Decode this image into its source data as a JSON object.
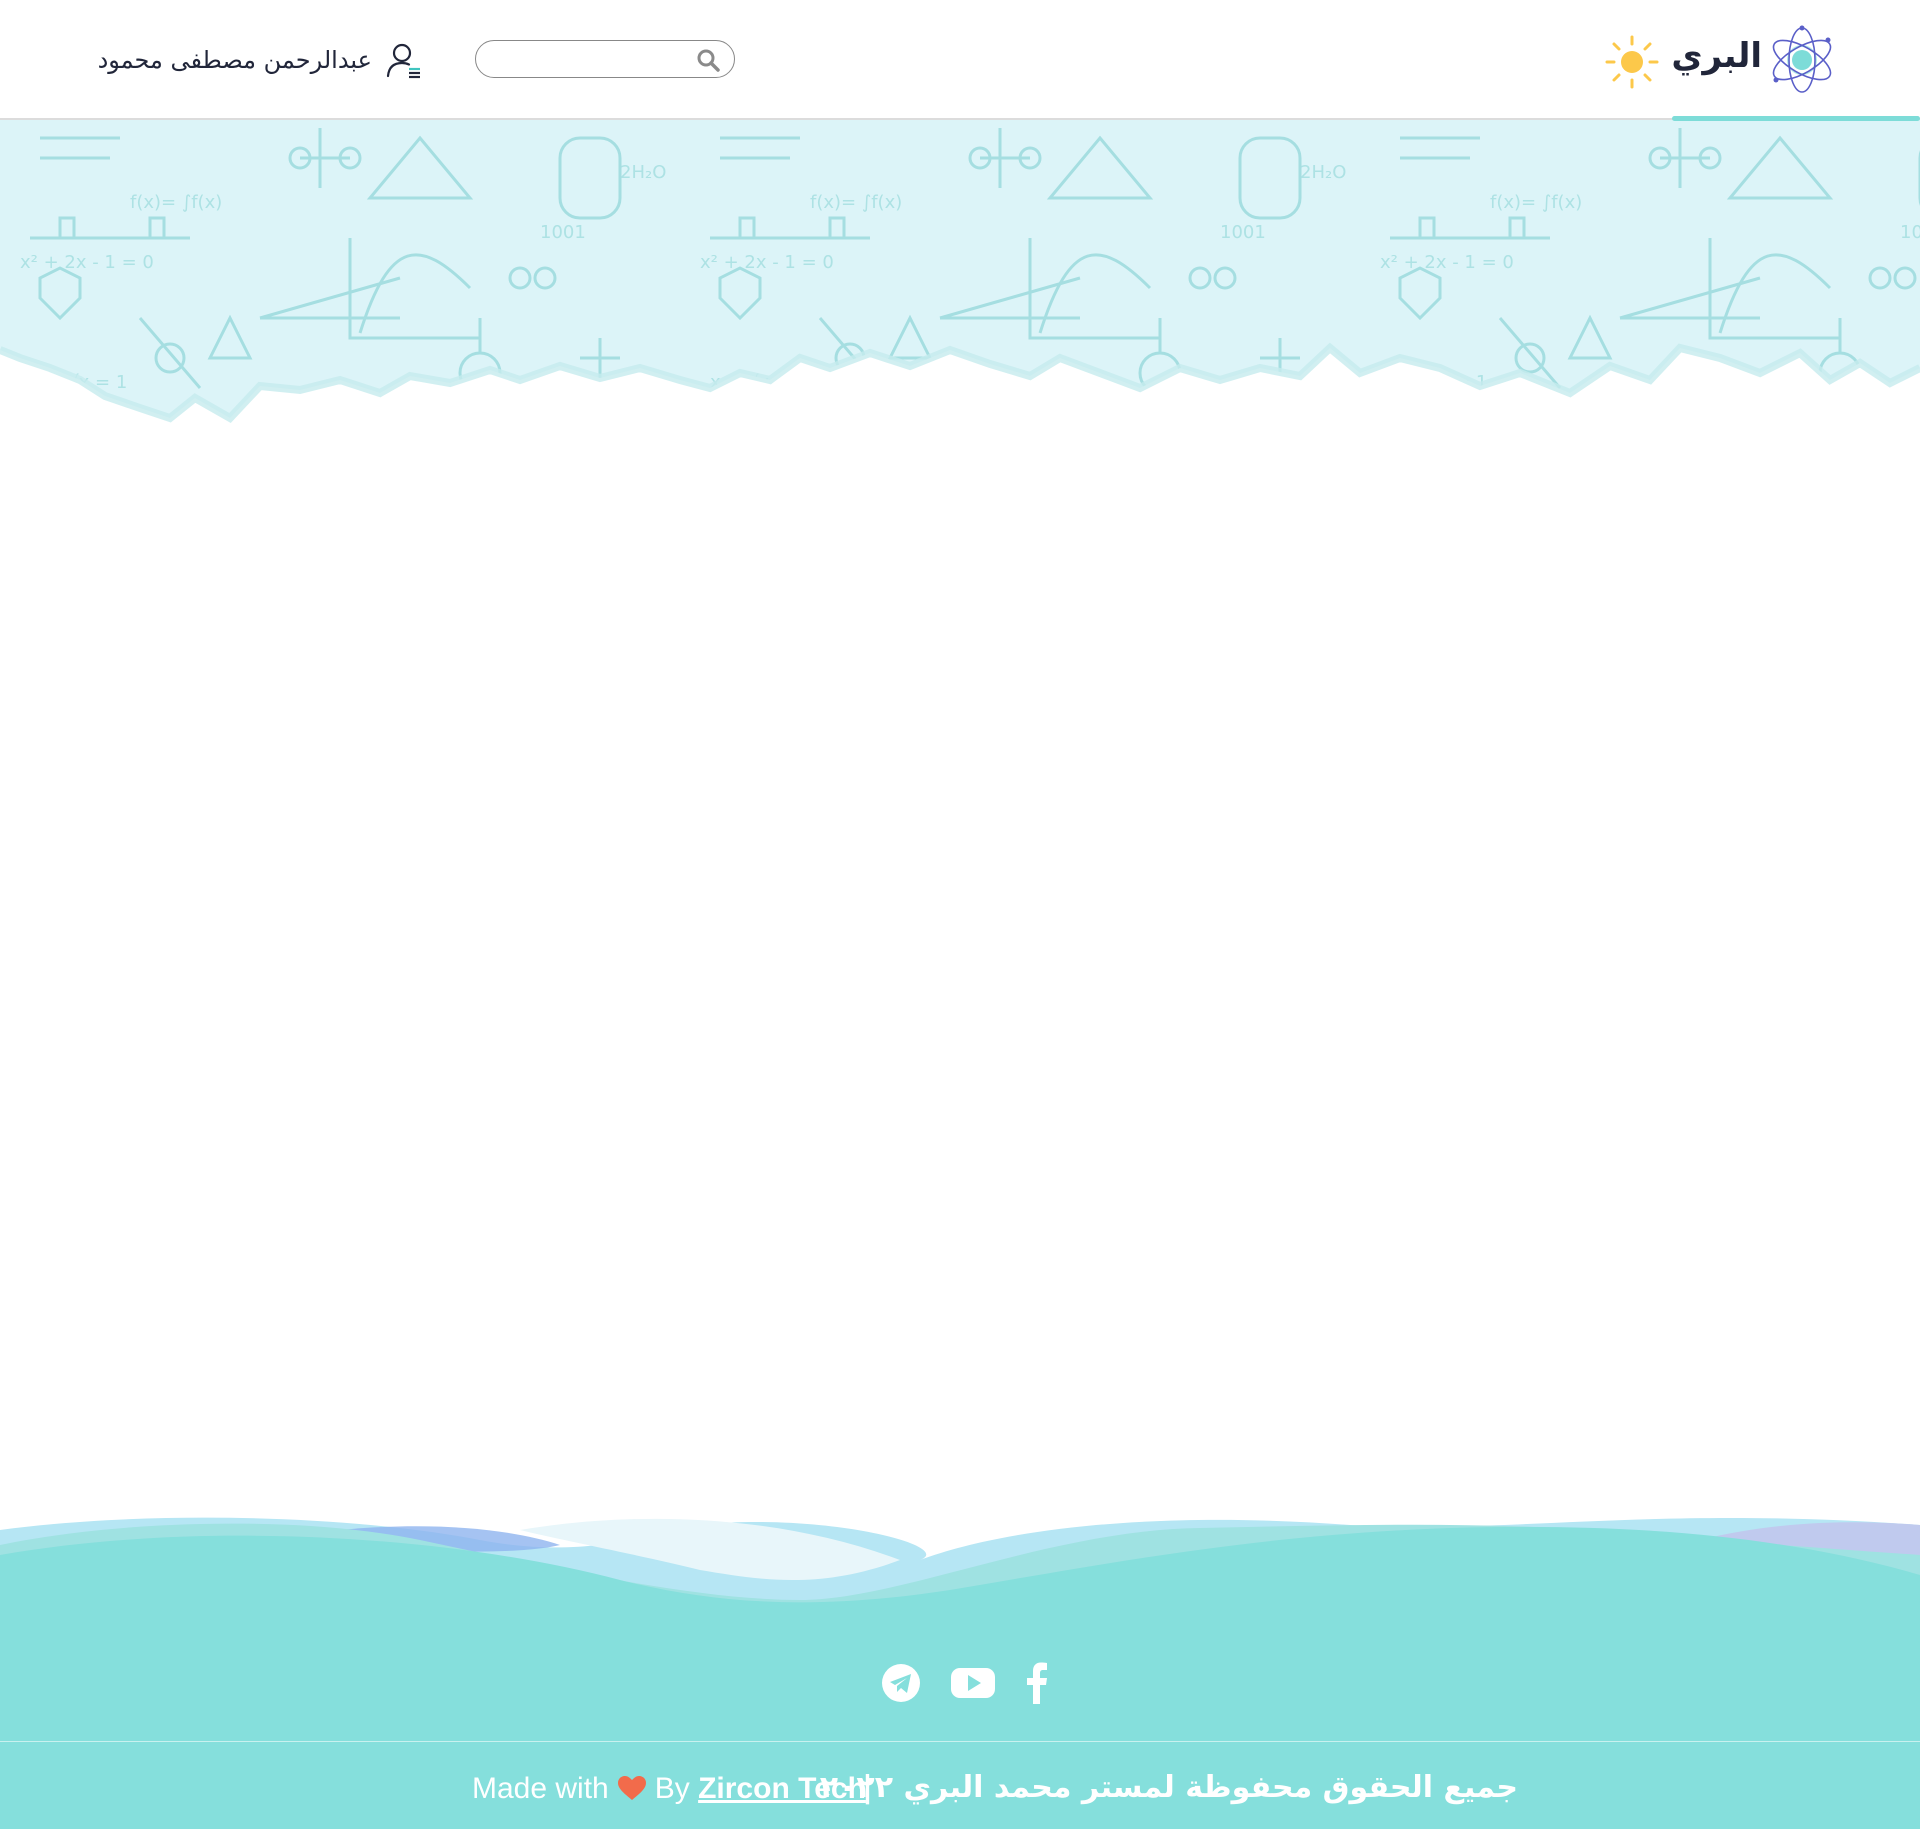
{
  "header": {
    "brand_name": "البري",
    "search_placeholder": "",
    "user_name": "عبدالرحمن مصطفى محمود",
    "icons": {
      "logo": "atom-logo-icon",
      "theme": "sun-icon",
      "search": "search-icon",
      "user": "user-menu-icon"
    },
    "accent_color": "#7ddcd8"
  },
  "footer": {
    "social": [
      {
        "name": "telegram",
        "icon": "telegram-icon"
      },
      {
        "name": "youtube",
        "icon": "youtube-icon"
      },
      {
        "name": "facebook",
        "icon": "facebook-icon"
      }
    ],
    "made_with": "Made with",
    "by": "By",
    "company": "Zircon Tech",
    "separator": "|",
    "rights": "جميع الحقوق محفوظة لمستر محمد البري ٢٠٢٢",
    "background_color": "#85dfdc"
  }
}
